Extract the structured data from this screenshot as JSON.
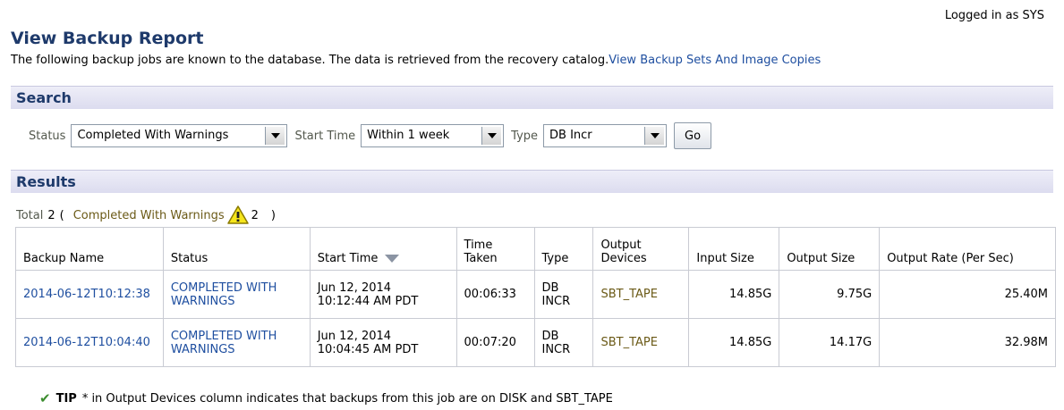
{
  "header": {
    "logged_in": "Logged in as SYS",
    "title": "View Backup Report",
    "description": "The following backup jobs are known to the database. The data is retrieved from the recovery catalog.",
    "link": "View Backup Sets And Image Copies"
  },
  "search": {
    "section_title": "Search",
    "status_label": "Status",
    "status_value": "Completed With Warnings",
    "start_time_label": "Start Time",
    "start_time_value": "Within 1 week",
    "type_label": "Type",
    "type_value": "DB Incr",
    "go_label": "Go"
  },
  "results": {
    "section_title": "Results",
    "total_label": "Total",
    "total_value": "2",
    "open_paren": "(",
    "filter_label": "Completed With Warnings",
    "filter_count": "2",
    "close_paren": ")",
    "columns": {
      "backup_name": "Backup Name",
      "status": "Status",
      "start_time": "Start Time",
      "time_taken": "Time Taken",
      "type": "Type",
      "output_devices": "Output Devices",
      "input_size": "Input Size",
      "output_size": "Output Size",
      "output_rate": "Output Rate (Per Sec)"
    },
    "rows": [
      {
        "backup_name": "2014-06-12T10:12:38",
        "status": "COMPLETED WITH WARNINGS",
        "start_time_date": "Jun 12, 2014",
        "start_time_clock": "10:12:44 AM PDT",
        "time_taken": "00:06:33",
        "type": "DB INCR",
        "output_devices": "SBT_TAPE",
        "input_size": "14.85G",
        "output_size": "9.75G",
        "output_rate": "25.40M"
      },
      {
        "backup_name": "2014-06-12T10:04:40",
        "status": "COMPLETED WITH WARNINGS",
        "start_time_date": "Jun 12, 2014",
        "start_time_clock": "10:04:45 AM PDT",
        "time_taken": "00:07:20",
        "type": "DB INCR",
        "output_devices": "SBT_TAPE",
        "input_size": "14.85G",
        "output_size": "14.17G",
        "output_rate": "32.98M"
      }
    ]
  },
  "tip": {
    "label": "TIP",
    "text": "* in Output Devices column indicates that backups from this job are on DISK and SBT_TAPE"
  },
  "icons": {
    "warning": "warning-triangle-icon",
    "sort": "sort-descending-icon",
    "tip": "check-icon",
    "dropdown": "chevron-down-icon"
  },
  "colors": {
    "title": "#1e3a6b",
    "link": "#1f4fa0",
    "filter_link": "#6b5a17",
    "section_bar": "#dcdcef",
    "warning": "#f5e51b"
  }
}
